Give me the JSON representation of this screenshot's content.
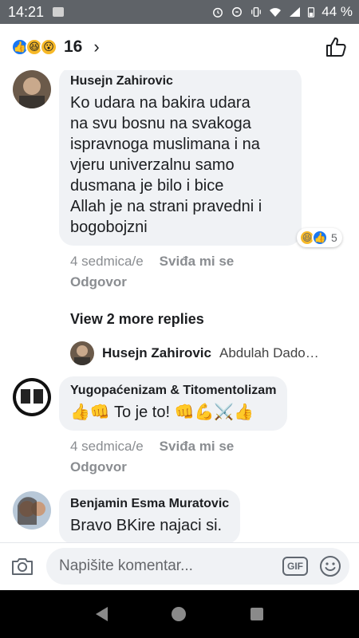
{
  "status_bar": {
    "time": "14:21",
    "battery": "44 %"
  },
  "header": {
    "reaction_count": "16",
    "reactions": [
      "like-icon",
      "haha-icon",
      "wow-icon"
    ],
    "chevron": "›"
  },
  "comments": [
    {
      "author": "Husejn Zahirovic",
      "text": "Ko udara na bakira udara\nna svu bosnu na svakoga\nispravnoga muslimana i na\nvjeru univerzalnu samo\ndusmana je bilo i bice\nAllah je na strani pravedni i\nbogobojzni",
      "time": "4 sedmica/e",
      "like_label": "Sviđa mi se",
      "reply_label": "Odgovor",
      "reaction_count": "5"
    },
    {
      "author": "Yugopaćenizam & Titomentolizam",
      "text": "👍👊 To je to! 👊💪⚔️👍",
      "time": "4 sedmica/e",
      "like_label": "Sviđa mi se",
      "reply_label": "Odgovor"
    },
    {
      "author": "Benjamin Esma Muratovic",
      "text": "Bravo BKire najaci si."
    }
  ],
  "view_more": "View 2 more replies",
  "nested_reply": {
    "author": "Husejn Zahirovic",
    "text": "Abdulah Dado…"
  },
  "composer": {
    "placeholder": "Napišite komentar...",
    "gif_label": "GIF"
  },
  "colors": {
    "like_blue": "#1877f2",
    "bubble_gray": "#f0f2f5",
    "meta_gray": "#8a8d91"
  }
}
